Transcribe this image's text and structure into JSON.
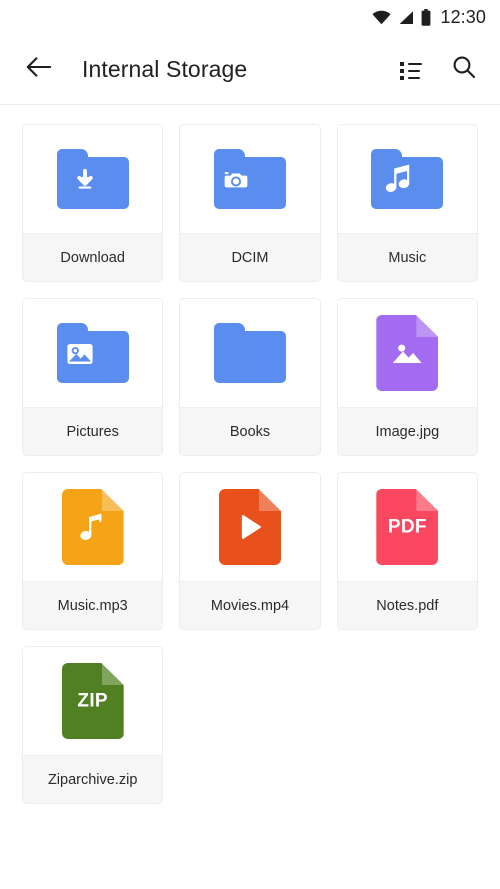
{
  "status_bar": {
    "wifi_icon": "wifi-icon",
    "signal_icon": "cellular-signal-icon",
    "battery_icon": "battery-icon",
    "clock": "12:30"
  },
  "app_bar": {
    "back_icon": "back-arrow-icon",
    "title": "Internal Storage",
    "view_toggle_icon": "list-view-icon",
    "search_icon": "search-icon"
  },
  "colors": {
    "folder_blue": "#5b8def",
    "image_purple": "#a36bf0",
    "audio_orange": "#f4a416",
    "video_orange": "#e8511c",
    "pdf_red": "#f9485f",
    "zip_green": "#508021",
    "tile_label_bg": "#f6f6f6",
    "text_primary": "#212121"
  },
  "grid": {
    "items": [
      {
        "label": "Download",
        "kind": "folder",
        "glyph": "download-arrow-icon",
        "color": "#5b8def",
        "ext": ""
      },
      {
        "label": "DCIM",
        "kind": "folder",
        "glyph": "camera-icon",
        "color": "#5b8def",
        "ext": ""
      },
      {
        "label": "Music",
        "kind": "folder",
        "glyph": "music-note-icon",
        "color": "#5b8def",
        "ext": ""
      },
      {
        "label": "Pictures",
        "kind": "folder",
        "glyph": "picture-icon",
        "color": "#5b8def",
        "ext": ""
      },
      {
        "label": "Books",
        "kind": "folder",
        "glyph": "plain-folder",
        "color": "#5b8def",
        "ext": ""
      },
      {
        "label": "Image.jpg",
        "kind": "file",
        "glyph": "picture-icon",
        "color": "#a36bf0",
        "ext": ""
      },
      {
        "label": "Music.mp3",
        "kind": "file",
        "glyph": "music-note-icon",
        "color": "#f4a416",
        "ext": ""
      },
      {
        "label": "Movies.mp4",
        "kind": "file",
        "glyph": "play-triangle-icon",
        "color": "#e8511c",
        "ext": ""
      },
      {
        "label": "Notes.pdf",
        "kind": "file",
        "glyph": "text-label",
        "color": "#f9485f",
        "ext": "PDF"
      },
      {
        "label": "Ziparchive.zip",
        "kind": "file",
        "glyph": "text-label",
        "color": "#508021",
        "ext": "ZIP"
      }
    ]
  }
}
